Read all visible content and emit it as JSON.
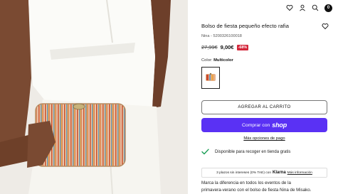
{
  "header": {
    "cart_count": "0"
  },
  "product": {
    "title": "Bolso de fiesta pequeño efecto rafia",
    "sku": "Nina - 5200326100018",
    "old_price": "27,99€",
    "price": "9,00€",
    "discount": "-68%",
    "color_label": "Color:",
    "color_value": "Multicolor"
  },
  "actions": {
    "add_to_cart": "AGREGAR AL CARRITO",
    "buy_with": "Comprar con",
    "shop_brand": "shop",
    "more_payment": "Más opciones de pago"
  },
  "pickup": {
    "text": "Disponible para recoger en tienda gratis"
  },
  "klarna": {
    "prefix": "3 plazos sin intereses (0% TAE) con",
    "brand": "Klarna",
    "link": "Más información"
  },
  "description": {
    "line1": "Marca la diferencia en todos los eventos de la",
    "line2": "primavera-verano con el bolso de fiesta Nina de Misako."
  },
  "colors": {
    "shop_button": "#5a31f4",
    "discount_badge": "#d3263a",
    "check": "#1a9e55"
  },
  "icons": [
    "heart-icon",
    "user-icon",
    "search-icon",
    "cart-icon",
    "check-icon"
  ]
}
